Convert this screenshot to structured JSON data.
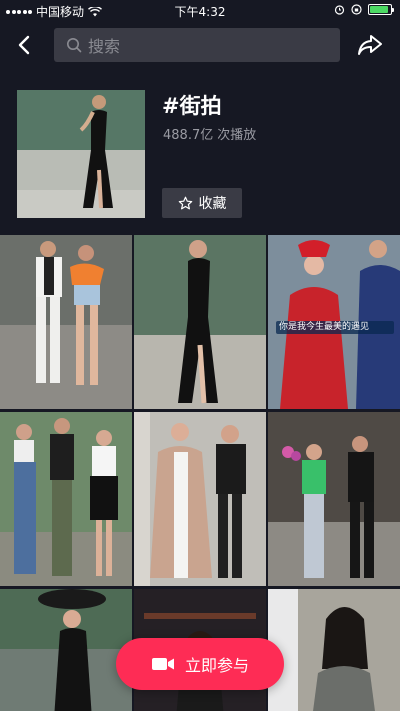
{
  "status_bar": {
    "carrier": "中国移动",
    "time": "下午4:32",
    "battery_level": 0.9,
    "battery_color": "#4cd964"
  },
  "top_bar": {
    "search_placeholder": "搜索",
    "back_icon": "chevron-left-icon",
    "share_icon": "share-arrow-icon"
  },
  "hashtag": {
    "title": "#街拍",
    "play_count": "488.7亿",
    "play_label": "次播放",
    "favorite_label": "收藏"
  },
  "videos": [
    {
      "id": 1,
      "caption": ""
    },
    {
      "id": 2,
      "caption": ""
    },
    {
      "id": 3,
      "caption": "你是我今生最美的遇见"
    },
    {
      "id": 4,
      "caption": ""
    },
    {
      "id": 5,
      "caption": ""
    },
    {
      "id": 6,
      "caption": ""
    },
    {
      "id": 7,
      "caption": ""
    },
    {
      "id": 8,
      "caption": ""
    },
    {
      "id": 9,
      "caption": ""
    }
  ],
  "join_button": {
    "label": "立即参与",
    "icon": "video-camera-icon",
    "color": "#fe2c55"
  },
  "colors": {
    "background": "#161823",
    "surface": "#3a3b45",
    "accent": "#fe2c55"
  }
}
